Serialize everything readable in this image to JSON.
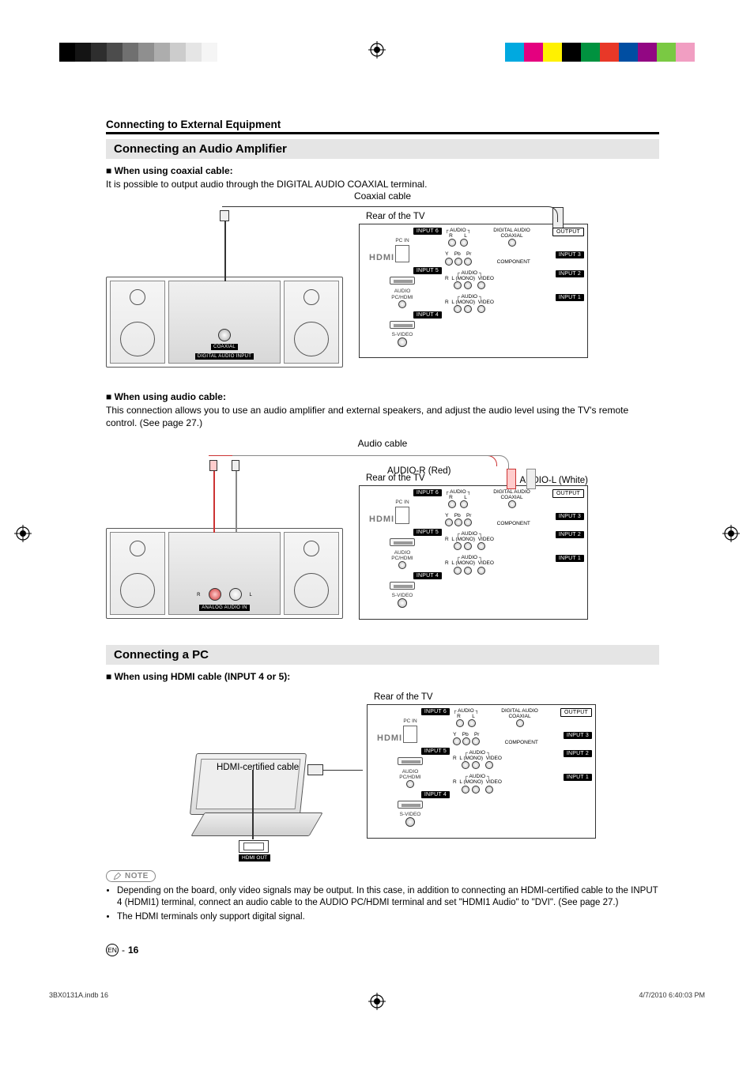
{
  "printer_marks": {
    "colors": [
      "#00a9e0",
      "#e4007f",
      "#fff100",
      "#000000",
      "#00923f",
      "#e83828",
      "#004ea2",
      "#920783",
      "#7ac943",
      "#f19ec2"
    ]
  },
  "chapter_title": "Connecting to External Equipment",
  "section1": {
    "title": "Connecting an Audio Amplifier",
    "sub1_label": "When using coaxial cable:",
    "sub1_text": "It is possible to output audio through the DIGITAL AUDIO COAXIAL terminal.",
    "fig1": {
      "caption": "Coaxial cable",
      "rear_label": "Rear of the TV",
      "stereo_port_label": "COAXIAL",
      "stereo_port_sub": "DIGITAL AUDIO INPUT"
    },
    "sub2_label": "When using audio cable:",
    "sub2_text": "This connection allows you to use an audio amplifier and external speakers, and adjust the audio level using the TV's remote control. (See page 27.)",
    "fig2": {
      "caption": "Audio cable",
      "rear_label": "Rear of the TV",
      "audio_r": "AUDIO-R (Red)",
      "audio_l": "AUDIO-L (White)",
      "stereo_r": "R",
      "stereo_l": "L",
      "stereo_port_sub": "ANALOG AUDIO IN"
    }
  },
  "tv_panel": {
    "hdmi_logo": "HDMI",
    "left_inputs": [
      "INPUT 6",
      "INPUT 5",
      "INPUT 4"
    ],
    "left_labels": {
      "pc_in": "PC  IN",
      "audio_pc": "AUDIO",
      "audio_pc2": "PC/HDMI",
      "svideo": "S-VIDEO"
    },
    "right": {
      "output_chip": "OUTPUT",
      "input3": "INPUT 3",
      "input2": "INPUT 2",
      "input1": "INPUT 1",
      "audio": "AUDIO",
      "r": "R",
      "l": "L",
      "lmono": "L (MONO)",
      "video": "VIDEO",
      "y": "Y",
      "pb": "Pb",
      "pr": "Pr",
      "component": "COMPONENT",
      "digital_audio": "DIGITAL AUDIO",
      "coaxial": "COAXIAL"
    }
  },
  "section2": {
    "title": "Connecting a PC",
    "sub1_label": "When using HDMI cable (INPUT 4 or 5):",
    "fig3": {
      "rear_label": "Rear of the TV",
      "cable_label": "HDMI-certified cable",
      "laptop_port": "HDMI OUT"
    },
    "note_label": "NOTE",
    "notes": [
      "Depending on the board, only video signals may be output. In this case, in addition to connecting an HDMI-certified cable to the INPUT 4 (HDMI1) terminal, connect an audio cable to the AUDIO PC/HDMI terminal and set \"HDMI1 Audio\" to \"DVI\". (See page 27.)",
      "The HDMI terminals only support digital signal."
    ]
  },
  "footer": {
    "lang": "EN",
    "sep": "-",
    "page": "16"
  },
  "print_footer": {
    "left": "3BX0131A.indb   16",
    "right": "4/7/2010   6:40:03 PM"
  }
}
